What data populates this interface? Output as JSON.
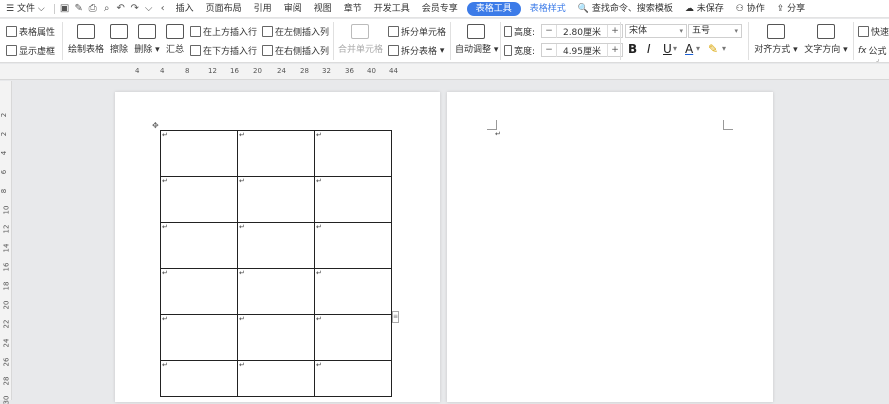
{
  "menubar": {
    "file_menu": "文件",
    "tabs": [
      "插入",
      "页面布局",
      "引用",
      "审阅",
      "视图",
      "章节",
      "开发工具",
      "会员专享"
    ],
    "active_tab": "表格工具",
    "style_tab": "表格样式",
    "search_placeholder": "查找命令、搜索模板",
    "unsaved": "未保存",
    "collaborate": "协作",
    "share": "分享"
  },
  "toolbar": {
    "table_props": "表格属性",
    "show_gridlines": "显示虚框",
    "draw_table": "绘制表格",
    "erase": "擦除",
    "delete": "删除",
    "summary": "汇总",
    "insert_row_above": "在上方插入行",
    "insert_row_below": "在下方插入行",
    "insert_col_left": "在左侧插入列",
    "insert_col_right": "在右侧插入列",
    "merge_cells": "合并单元格",
    "split_cells": "拆分单元格",
    "split_table": "拆分表格",
    "auto_fit": "自动调整",
    "height_label": "高度:",
    "height_value": "2.80厘米",
    "width_label": "宽度:",
    "width_value": "4.95厘米",
    "font_name": "宋体",
    "font_size": "五号",
    "align": "对齐方式",
    "text_dir": "文字方向",
    "quick_calc": "快速",
    "formula": "公式"
  },
  "ruler": {
    "h_ticks": [
      "4",
      "4",
      "8",
      "12",
      "16",
      "20",
      "24",
      "28",
      "32",
      "36",
      "40",
      "44"
    ],
    "v_ticks": [
      "2",
      "2",
      "4",
      "6",
      "8",
      "10",
      "12",
      "14",
      "16",
      "18",
      "20",
      "22",
      "24",
      "26",
      "28",
      "30"
    ]
  },
  "document": {
    "paragraph_mark": "↵",
    "table_rows": 6,
    "table_cols": 3
  }
}
